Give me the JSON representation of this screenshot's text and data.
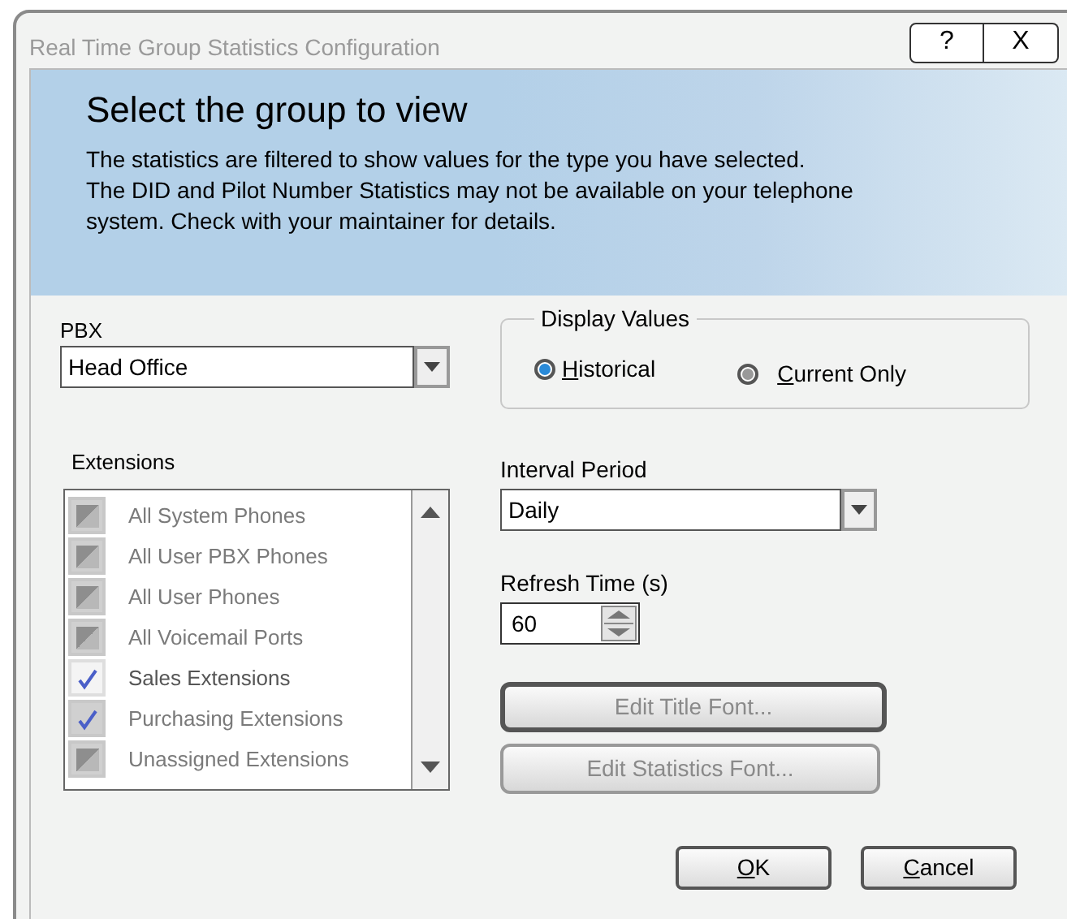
{
  "window": {
    "title": "Real Time Group Statistics Configuration",
    "title_buttons": [
      "?",
      "X"
    ]
  },
  "header": {
    "heading": "Select the group to view",
    "description": "The statistics are filtered to show values for the type you have selected.\nThe DID and Pilot Number Statistics may not be available on your telephone\nsystem. Check with your maintainer for details."
  },
  "pbx": {
    "label": "PBX",
    "value": "Head Office"
  },
  "display_values": {
    "label": "Display Values",
    "options": [
      {
        "label": "Historical",
        "selected": true,
        "mnemonic": true
      },
      {
        "label": "Current Only",
        "selected": false,
        "mnemonic": true
      }
    ]
  },
  "extensions": {
    "label": "Extensions",
    "items": [
      {
        "label": "All System Phones",
        "checked": false,
        "disabled": true
      },
      {
        "label": "All User PBX Phones",
        "checked": false,
        "disabled": true
      },
      {
        "label": "All User Phones",
        "checked": false,
        "disabled": true
      },
      {
        "label": "All Voicemail Ports",
        "checked": false,
        "disabled": true
      },
      {
        "label": "Sales Extensions",
        "checked": true,
        "disabled": false
      },
      {
        "label": "Purchasing Extensions",
        "checked": true,
        "disabled": true
      },
      {
        "label": "Unassigned Extensions",
        "checked": false,
        "disabled": true
      }
    ]
  },
  "interval_period": {
    "label": "Interval Period",
    "value": "Daily"
  },
  "refresh_time": {
    "label": "Refresh Time (s)",
    "value": "60"
  },
  "font_buttons": [
    {
      "label": "Edit Title Font...",
      "focused": true,
      "disabled": true
    },
    {
      "label": "Edit Statistics Font...",
      "focused": false,
      "disabled": true
    }
  ],
  "dialog_buttons": [
    {
      "label": "OK",
      "mnemonic": true
    },
    {
      "label": "Cancel",
      "mnemonic": true
    }
  ]
}
